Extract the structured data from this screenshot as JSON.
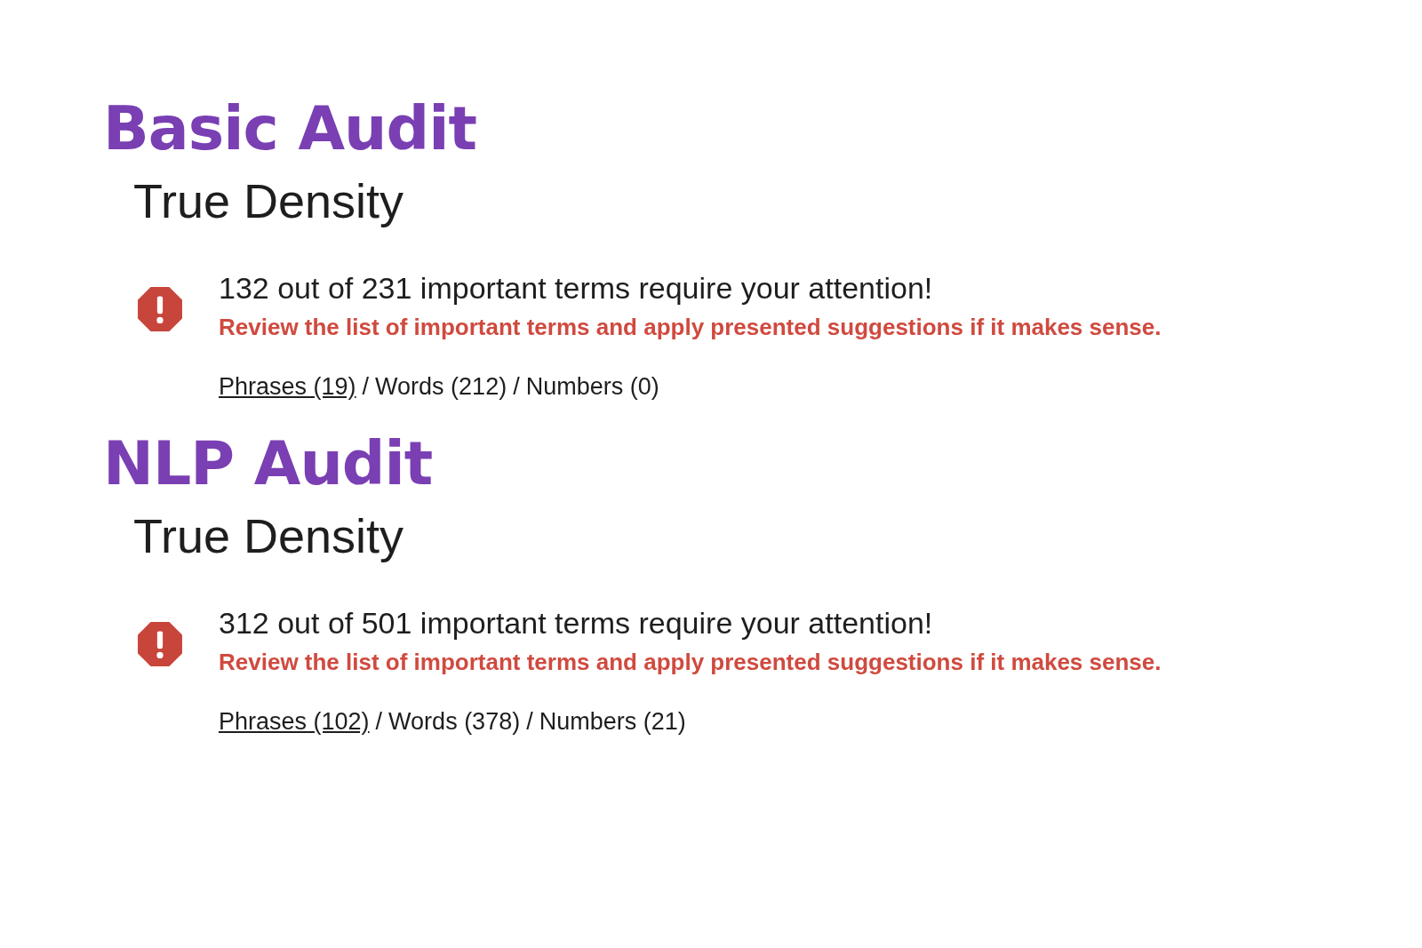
{
  "sections": [
    {
      "title": "Basic Audit",
      "subtitle": "True Density",
      "message": "132 out of 231 important terms require your attention!",
      "hint": "Review the list of important terms and apply presented suggestions if it makes sense.",
      "filters": [
        {
          "label": "Phrases (19)",
          "selected": true
        },
        {
          "label": "Words (212)",
          "selected": false
        },
        {
          "label": "Numbers (0)",
          "selected": false
        }
      ],
      "separators": [
        "/",
        "/"
      ]
    },
    {
      "title": "NLP Audit",
      "subtitle": "True Density",
      "message": "312 out of 501 important terms require your attention!",
      "hint": "Review the list of important terms and apply presented suggestions if it makes sense.",
      "filters": [
        {
          "label": "Phrases (102)",
          "selected": true
        },
        {
          "label": "Words (378)",
          "selected": false
        },
        {
          "label": "Numbers (21)",
          "selected": false
        }
      ],
      "separators": [
        "/",
        "/"
      ]
    }
  ]
}
